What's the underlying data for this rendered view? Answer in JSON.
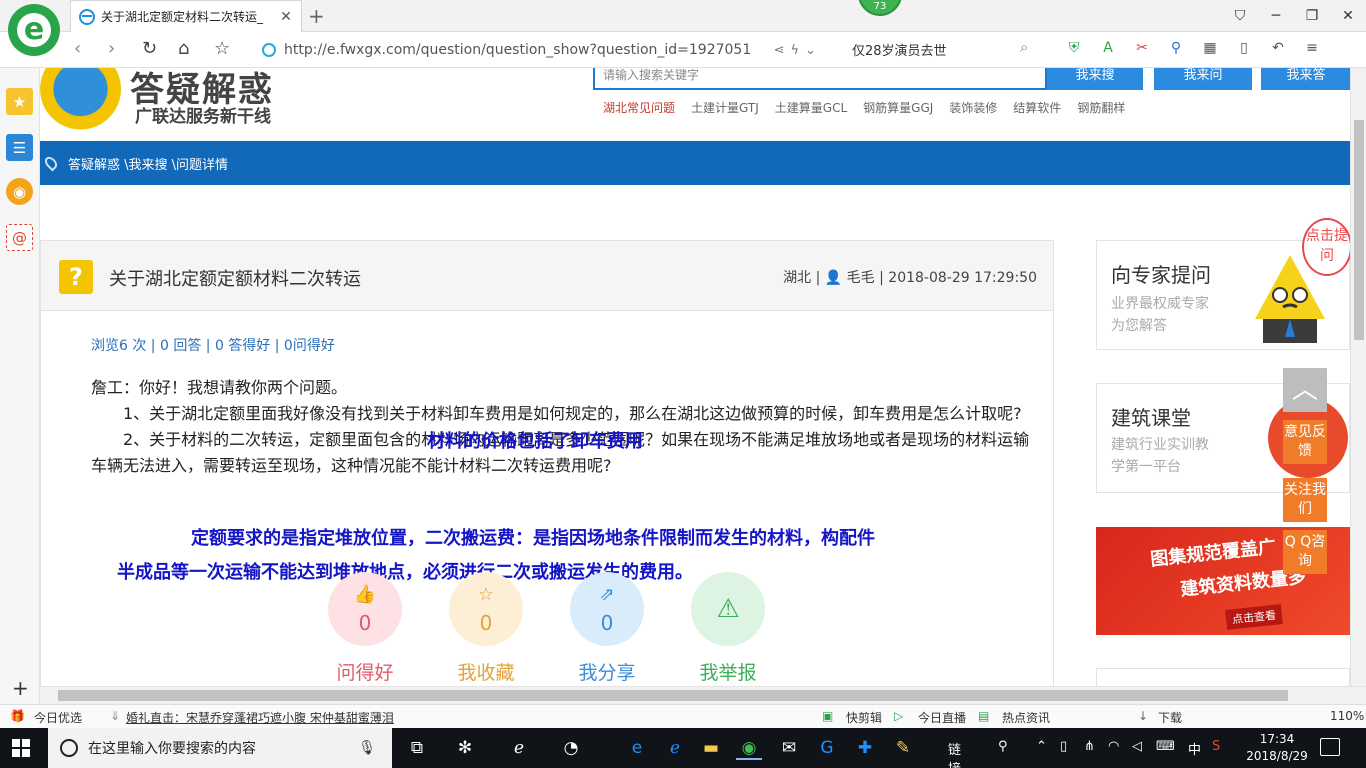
{
  "browser": {
    "tab_title": "关于湖北定额定材料二次转运_",
    "tab_close": "✕",
    "new_tab": "+",
    "badge": "73",
    "url": "http://e.fwxgx.com/question/question_show?question_id=1927051",
    "search_hint": "仅28岁演员去世",
    "zoom": "110%"
  },
  "site": {
    "logo_text": "答疑解惑",
    "slogan": "广联达服务新干线",
    "search_placeholder": "请输入搜索关键字",
    "btn_search": "我来搜",
    "btn_ask": "我来问",
    "btn_answer": "我来答",
    "quicklinks": [
      "湖北常见问题",
      "土建计量GTJ",
      "土建算量GCL",
      "钢筋算量GGJ",
      "装饰装修",
      "结算软件",
      "钢筋翻样"
    ],
    "breadcrumb": "答疑解惑 \\我来搜 \\问题详情"
  },
  "question": {
    "title": "关于湖北定额定额材料二次转运",
    "region": "湖北",
    "author": "毛毛",
    "date": "2018-08-29 17:29:50",
    "stats": "浏览6 次 | 0 回答 | 0 答得好 | 0问得好",
    "greeting": "詹工：你好！我想请教你两个问题。",
    "q1": "1、关于湖北定额里面我好像没有找到关于材料卸车费用是如何规定的，那么在湖北这边做预算的时候，卸车费用是怎么计取呢?",
    "q2": "2、关于材料的二次转运，定额里面包含的材料场内运输距离是多少范围呢？如果在现场不能满足堆放场地或者是现场的材料运输车辆无法进入，需要转运至现场，这种情况能不能计材料二次转运费用呢?",
    "annotation1": "材料的价格包括了卸车费用",
    "annotation2": "定额要求的是指定堆放位置，二次搬运费：是指因场地条件限制而发生的材料，构配件",
    "annotation3": "半成品等一次运输不能达到堆放地点，必须进行二次或搬运发生的费用。"
  },
  "actions": [
    {
      "label": "问得好",
      "count": "0",
      "color": "#e05a6a",
      "bg": "#fde1e4"
    },
    {
      "label": "我收藏",
      "count": "0",
      "color": "#e3a23a",
      "bg": "#fdefd6"
    },
    {
      "label": "我分享",
      "count": "0",
      "color": "#3a8fd8",
      "bg": "#d9ecfb"
    },
    {
      "label": "我举报",
      "count": "",
      "color": "#3dae5c",
      "bg": "#dcf4e1"
    }
  ],
  "sidebar": {
    "expert_title": "向专家提问",
    "expert_desc1": "业界最权威专家",
    "expert_desc2": "为您解答",
    "bubble": "点击提问",
    "course_title": "建筑课堂",
    "course_desc1": "建筑行业实训教",
    "course_desc2": "学第一平台",
    "banner1": "图集规范覆盖广",
    "banner2": "建筑资料数量多",
    "banner3": "点击查看",
    "feedback": "意见反馈",
    "follow": "关注我们",
    "qq": "Q Q咨询"
  },
  "statusbar": {
    "left1": "今日优选",
    "news": "婚礼直击：宋慧乔穿蓬裙巧遮小腹 宋仲基甜蜜薄泪",
    "r1": "快剪辑",
    "r2": "今日直播",
    "r3": "热点资讯",
    "r4": "下载",
    "zoom": "110%"
  },
  "taskbar": {
    "search_placeholder": "在这里输入你要搜索的内容",
    "links": "链接",
    "ime": "中",
    "time": "17:34",
    "date": "2018/8/29"
  }
}
